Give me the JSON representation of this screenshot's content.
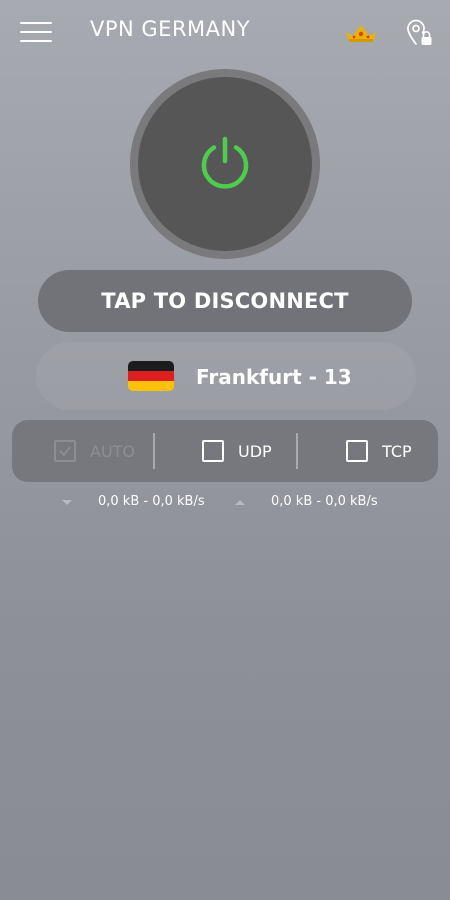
{
  "header": {
    "title": "VPN GERMANY",
    "menu_icon": "hamburger-menu-icon",
    "premium_icon": "crown-icon",
    "location_icon": "location-lock-icon"
  },
  "connection": {
    "power_icon": "power-icon",
    "power_color": "#4cce4c",
    "button_label": "TAP TO DISCONNECT"
  },
  "server": {
    "flag_icon": "germany-flag-icon",
    "name": "Frankfurt - 13"
  },
  "protocols": [
    {
      "label": "AUTO",
      "checked": true,
      "disabled": true
    },
    {
      "label": "UDP",
      "checked": false,
      "disabled": false
    },
    {
      "label": "TCP",
      "checked": false,
      "disabled": false
    }
  ],
  "traffic": {
    "download": "0,0 kB - 0,0 kB/s",
    "upload": "0,0 kB - 0,0 kB/s"
  },
  "colors": {
    "accent_green": "#4cce4c",
    "crown_gold": "#e8b400",
    "crown_red": "#e04020"
  }
}
